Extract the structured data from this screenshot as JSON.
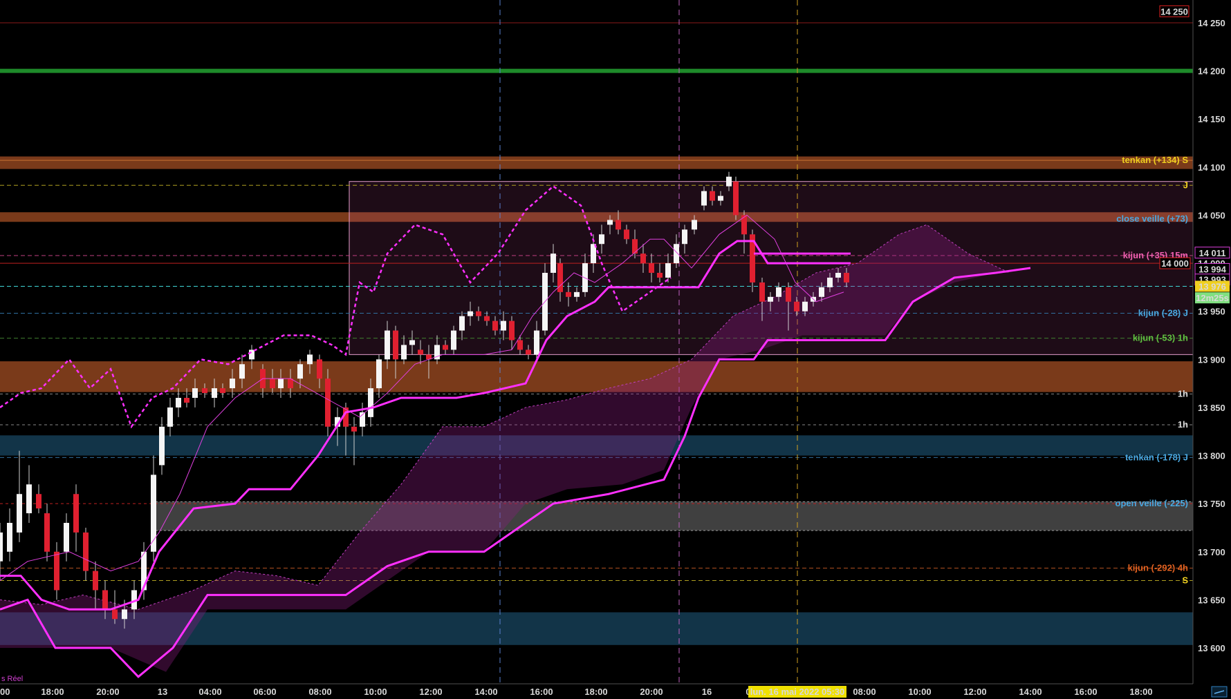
{
  "chart_data": {
    "type": "candlestick",
    "y_axis": {
      "range": [
        13585,
        14265
      ],
      "ticks": [
        "14 250",
        "14 200",
        "14 150",
        "14 100",
        "14 050",
        "14 000",
        "13 950",
        "13 900",
        "13 850",
        "13 800",
        "13 750",
        "13 700",
        "13 650",
        "13 600"
      ],
      "tick_values": [
        14250,
        14200,
        14150,
        14100,
        14050,
        14000,
        13950,
        13900,
        13850,
        13800,
        13750,
        13700,
        13650,
        13600
      ]
    },
    "x_axis": {
      "ticks": [
        "00",
        "18:00",
        "20:00",
        "13",
        "04:00",
        "06:00",
        "08:00",
        "10:00",
        "12:00",
        "14:00",
        "16:00",
        "18:00",
        "20:00",
        "16",
        "0",
        "08:00",
        "10:00",
        "12:00",
        "14:00",
        "16:00",
        "18:00"
      ],
      "crosshair_label": "lun. 16 mai 2022 05:30"
    },
    "price_badges": [
      {
        "text": "14 250",
        "value": 14262,
        "color": "#e02020",
        "style": "outline"
      },
      {
        "text": "14 011",
        "value": 14011,
        "color": "#e040e0",
        "style": "outline"
      },
      {
        "text": "14 000",
        "value": 14000,
        "color": "#e02020",
        "style": "outline"
      },
      {
        "text": "13 994",
        "value": 13994,
        "color": "#e040e0",
        "style": "outline"
      },
      {
        "text": "13 993",
        "value": 13983,
        "color": "#e040e0",
        "style": "outline"
      },
      {
        "text": "13 976",
        "value": 13976,
        "color": "#f0d020",
        "style": "fill"
      },
      {
        "text": "12m25s",
        "value": 13964,
        "color": "#80e080",
        "style": "fill"
      }
    ],
    "level_labels": [
      {
        "text": "tenkan (+134) S",
        "value": 14107,
        "color": "#f0d020"
      },
      {
        "text": "J",
        "value": 14081,
        "color": "#f0d020"
      },
      {
        "text": "close veille (+73)",
        "value": 14046,
        "color": "#4aa8e0"
      },
      {
        "text": "kijun (+35) 15m",
        "value": 14008,
        "color": "#f060b0"
      },
      {
        "text": "kijun (-28) J",
        "value": 13948,
        "color": "#4aa8e0"
      },
      {
        "text": "kijun (-53) 1h",
        "value": 13922,
        "color": "#60c040"
      },
      {
        "text": "1h",
        "value": 13864,
        "color": "#d8d8d8"
      },
      {
        "text": "1h",
        "value": 13832,
        "color": "#d8d8d8"
      },
      {
        "text": "tenkan (-178) J",
        "value": 13798,
        "color": "#4aa8e0"
      },
      {
        "text": "open veille (-225)",
        "value": 13750,
        "color": "#4aa8e0"
      },
      {
        "text": "kijun (-292) 4h",
        "value": 13683,
        "color": "#e06020"
      },
      {
        "text": "S",
        "value": 13670,
        "color": "#f0d020"
      }
    ],
    "zones": [
      {
        "from": 14098,
        "to": 14111,
        "color": "#7a3a1a"
      },
      {
        "from": 14043,
        "to": 14053,
        "color": "#7a3a1a"
      },
      {
        "from": 13866,
        "to": 13898,
        "color": "#7a3a1a"
      },
      {
        "from": 13800,
        "to": 13821,
        "color": "#123448"
      },
      {
        "from": 13603,
        "to": 13637,
        "color": "#123448"
      },
      {
        "from": 13722,
        "to": 13752,
        "color": "#404040",
        "x_from": "13"
      }
    ],
    "green_line": 14200,
    "current_price": 13976,
    "corner_label": "s Réel"
  }
}
